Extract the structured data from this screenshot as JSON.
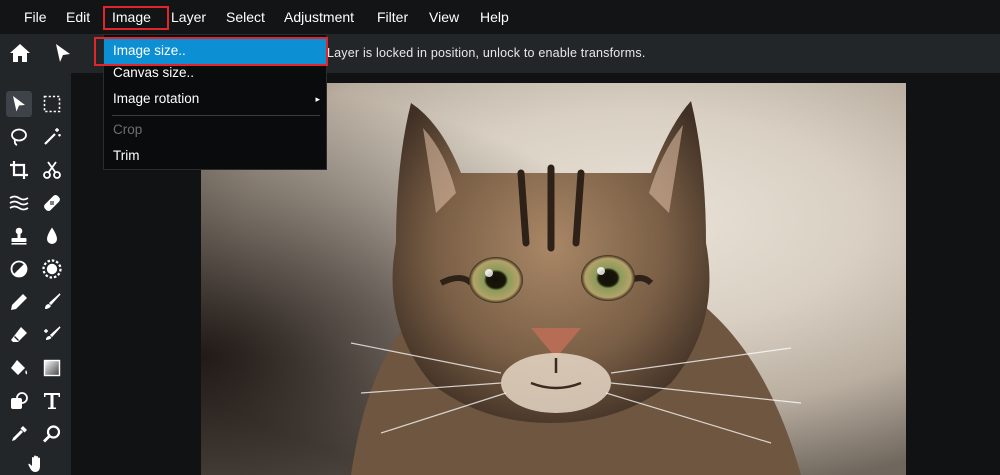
{
  "menubar": {
    "items": [
      {
        "label": "File"
      },
      {
        "label": "Edit"
      },
      {
        "label": "Image"
      },
      {
        "label": "Layer"
      },
      {
        "label": "Select"
      },
      {
        "label": "Adjustment"
      },
      {
        "label": "Filter"
      },
      {
        "label": "View"
      },
      {
        "label": "Help"
      }
    ]
  },
  "optionsbar": {
    "home_icon": "home-icon",
    "tool_icon": "move-arrow-icon",
    "message": "Layer is locked in position, unlock to enable transforms."
  },
  "image_menu": {
    "items": [
      {
        "label": "Image size..",
        "state": "highlighted"
      },
      {
        "label": "Canvas size..",
        "state": "normal"
      },
      {
        "label": "Image rotation",
        "state": "submenu"
      },
      {
        "label": "Crop",
        "state": "disabled"
      },
      {
        "label": "Trim",
        "state": "normal"
      }
    ],
    "submenu_arrow": "▸"
  },
  "toolbox": {
    "tools": [
      "move-tool-icon",
      "marquee-tool-icon",
      "lasso-tool-icon",
      "magic-wand-tool-icon",
      "crop-tool-icon",
      "cut-tool-icon",
      "liquify-tool-icon",
      "healing-tool-icon",
      "clone-stamp-tool-icon",
      "blur-tool-icon",
      "dodge-tool-icon",
      "sponge-tool-icon",
      "pencil-tool-icon",
      "brush-tool-icon",
      "eraser-tool-icon",
      "color-replace-tool-icon",
      "paint-bucket-tool-icon",
      "gradient-tool-icon",
      "shape-tool-icon",
      "type-tool-icon",
      "eyedropper-tool-icon",
      "zoom-tool-icon",
      "hand-tool-icon"
    ]
  },
  "colors": {
    "highlight": "#0d8fd3",
    "annotation": "#e0252b",
    "toolbar": "#232629",
    "menubar": "#121416"
  },
  "canvas": {
    "content": "tabby cat photo"
  }
}
